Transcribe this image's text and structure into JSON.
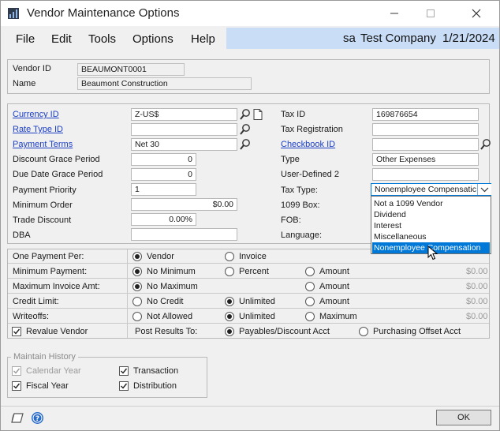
{
  "window": {
    "title": "Vendor Maintenance Options"
  },
  "menu": {
    "items": [
      "File",
      "Edit",
      "Tools",
      "Options",
      "Help"
    ],
    "user": "sa",
    "company": "Test Company",
    "date": "1/21/2024"
  },
  "vendor": {
    "id_label": "Vendor ID",
    "id": "BEAUMONT0001",
    "name_label": "Name",
    "name": "Beaumont Construction"
  },
  "left": {
    "currency_label": "Currency ID",
    "currency": "Z-US$",
    "rate_type_label": "Rate Type ID",
    "rate_type": "",
    "payment_terms_label": "Payment Terms",
    "payment_terms": "Net 30",
    "discount_grace_label": "Discount Grace Period",
    "discount_grace": "0",
    "due_grace_label": "Due Date Grace Period",
    "due_grace": "0",
    "priority_label": "Payment Priority",
    "priority": "1",
    "min_order_label": "Minimum Order",
    "min_order": "$0.00",
    "trade_discount_label": "Trade Discount",
    "trade_discount": "0.00%",
    "dba_label": "DBA",
    "dba": ""
  },
  "right": {
    "tax_id_label": "Tax ID",
    "tax_id": "169876654",
    "tax_reg_label": "Tax Registration",
    "tax_reg": "",
    "checkbook_label": "Checkbook ID",
    "checkbook": "",
    "type_label": "Type",
    "type": "Other Expenses",
    "user_defined_label": "User-Defined 2",
    "user_defined": "",
    "tax_type_label": "Tax Type:",
    "tax_type": "Nonemployee Compensatic",
    "box_label": "1099 Box:",
    "fob_label": "FOB:",
    "language_label": "Language:"
  },
  "dropdown": {
    "options": [
      "Not a 1099 Vendor",
      "Dividend",
      "Interest",
      "Miscellaneous",
      "Nonemployee Compensation"
    ],
    "selected_index": 4
  },
  "options_grid": {
    "one_payment": {
      "label": "One Payment Per:",
      "opt1": "Vendor",
      "opt2": "Invoice"
    },
    "min_payment": {
      "label": "Minimum Payment:",
      "opt1": "No Minimum",
      "opt2": "Percent",
      "opt3": "Amount",
      "value": "$0.00"
    },
    "max_invoice": {
      "label": "Maximum Invoice Amt:",
      "opt1": "No Maximum",
      "opt3": "Amount",
      "value": "$0.00"
    },
    "credit_limit": {
      "label": "Credit Limit:",
      "opt1": "No Credit",
      "opt2": "Unlimited",
      "opt3": "Amount",
      "value": "$0.00"
    },
    "writeoffs": {
      "label": "Writeoffs:",
      "opt1": "Not Allowed",
      "opt2": "Unlimited",
      "opt3": "Maximum",
      "value": "$0.00"
    },
    "revalue": {
      "label": "Revalue Vendor",
      "post_label": "Post Results To:",
      "opt1": "Payables/Discount Acct",
      "opt2": "Purchasing Offset Acct"
    }
  },
  "history": {
    "title": "Maintain History",
    "calendar_year": "Calendar Year",
    "fiscal_year": "Fiscal Year",
    "transaction": "Transaction",
    "distribution": "Distribution"
  },
  "buttons": {
    "ok": "OK"
  },
  "colors": {
    "link": "#1c3fc4",
    "menu_highlight": "#c9ddf7",
    "selection": "#0078d7"
  }
}
